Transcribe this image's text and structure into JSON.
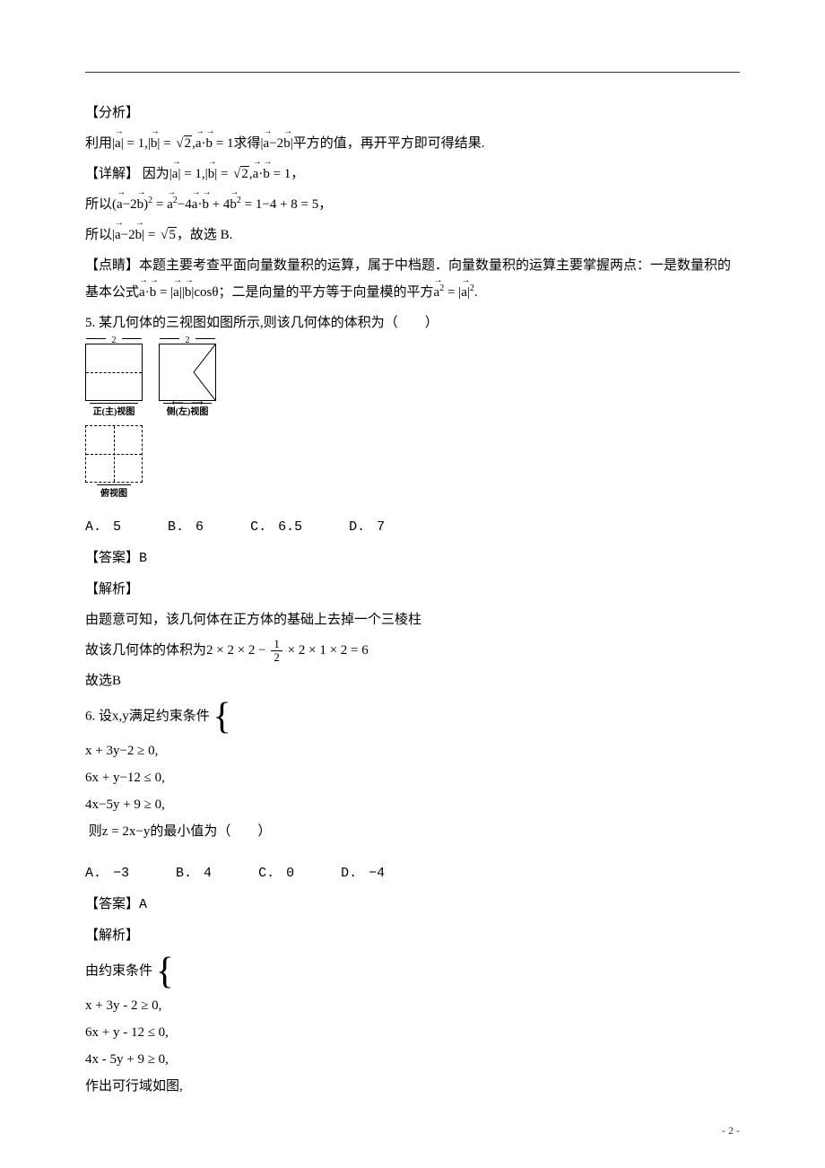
{
  "analysis": {
    "heading": "【分析】",
    "line1_pre": "利用",
    "line1_eq": "|a| = 1, |b| = √2, a·b = 1",
    "line1_mid": "求得",
    "line1_exp": "|a−2b|",
    "line1_post": "平方的值，再开平方即可得结果."
  },
  "detail": {
    "heading": "【详解】",
    "line1_pre": "因为",
    "line1_eq": "|a| = 1, |b| = √2, a·b = 1",
    "line1_post": "，",
    "line2_pre": "所以",
    "line2_eq": "(a−2b)² = a² − 4a·b + 4b² = 1 − 4 + 8 = 5",
    "line2_post": "，",
    "line3_pre": "所以",
    "line3_eq": "|a−2b| = √5",
    "line3_post": "，故选 B."
  },
  "dianjing": {
    "heading": "【点睛】",
    "text1": "本题主要考查平面向量数量积的运算，属于中档题．向量数量积的运算主要掌握两点：一是数量积的基本公式",
    "formula1": "a·b = |a||b|cosθ",
    "text2": "；二是向量的平方等于向量模的平方",
    "formula2": "a² = |a|²",
    "text3": "."
  },
  "q5": {
    "stem": "5. 某几何体的三视图如图所示,则该几何体的体积为（　　）",
    "views": {
      "dim": "2",
      "front_label": "正(主)视图",
      "side_label": "侧(左)视图",
      "top_label": "俯视图"
    },
    "opts": {
      "A": "A. 5",
      "B": "B. 6",
      "C": "C. 6.5",
      "D": "D. 7"
    },
    "answer_label": "【答案】",
    "answer": "B",
    "jiexi_label": "【解析】",
    "jiexi1": "由题意可知，该几何体在正方体的基础上去掉一个三棱柱",
    "jiexi2_pre": "故该几何体的体积为",
    "jiexi2_expr": "2 × 2 × 2 −",
    "jiexi2_frac_num": "1",
    "jiexi2_frac_den": "2",
    "jiexi2_expr2": "× 2 × 1 × 2 = 6",
    "jiexi3": "故选B"
  },
  "q6": {
    "stem_pre": "6. 设x,y满足约束条件",
    "constraints": {
      "c1": "x + 3y−2 ≥ 0,",
      "c2": "6x + y−12 ≤ 0,",
      "c3": "4x−5y + 9 ≥ 0,"
    },
    "stem_post": "则z = 2x−y的最小值为（　　）",
    "opts": {
      "A": "A. −3",
      "B": "B. 4",
      "C": "C. 0",
      "D": "D. −4"
    },
    "answer_label": "【答案】",
    "answer": "A",
    "jiexi_label": "【解析】",
    "jiexi_pre": "由约束条件",
    "constraints2": {
      "c1": "x + 3y - 2 ≥ 0,",
      "c2": "6x + y - 12 ≤ 0,",
      "c3": "4x - 5y + 9 ≥ 0,"
    },
    "jiexi_post": "作出可行域如图,"
  },
  "page_number": "- 2 -"
}
